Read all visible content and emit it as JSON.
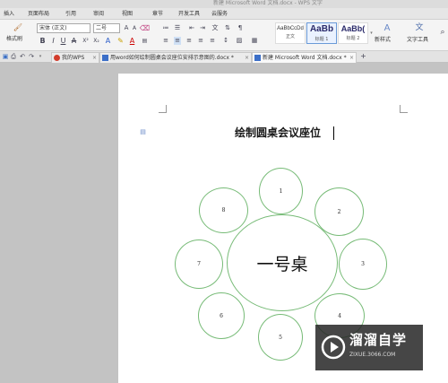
{
  "window": {
    "title": "新建 Microsoft Word 文档.docx - WPS 文字"
  },
  "menu": [
    "插入",
    "页面布局",
    "引用",
    "审阅",
    "视图",
    "章节",
    "开发工具",
    "云服务"
  ],
  "ribbon": {
    "format_painter": "格式刷",
    "font_name": "宋体 (正文)",
    "font_size": "二号",
    "styles": [
      {
        "preview": "AaBbCcDd",
        "caption": "正文"
      },
      {
        "preview": "AaBb",
        "caption": "标题 1"
      },
      {
        "preview": "AaBb(",
        "caption": "标题 2"
      }
    ],
    "new_style": "新样式",
    "text_tools": "文字工具"
  },
  "tabs": [
    {
      "label": "我的WPS"
    },
    {
      "label": "用word如何绘制圆桌会议座位安排示意图的.docx *"
    },
    {
      "label": "新建 Microsoft Word 文档.docx *"
    }
  ],
  "tab_add": "+",
  "document": {
    "title": "绘制圆桌会议座位",
    "table_label": "一号桌",
    "seats": [
      "1",
      "2",
      "3",
      "4",
      "5",
      "6",
      "7",
      "8"
    ]
  },
  "watermark": {
    "brand": "溜溜自学",
    "url": "ZIXUE.3066.COM"
  },
  "colors": {
    "circle_stroke": "#77bb77",
    "page": "#ffffff",
    "canvas": "#c3c3c3"
  }
}
